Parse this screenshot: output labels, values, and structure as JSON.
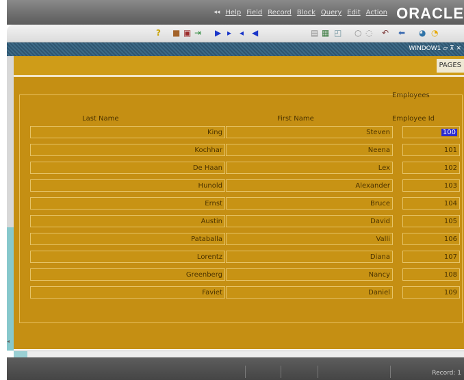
{
  "menu": {
    "items": [
      "Help",
      "Field",
      "Record",
      "Block",
      "Query",
      "Edit",
      "Action"
    ],
    "logo": "ORACLE"
  },
  "toolbar": {
    "icons": [
      "help-icon",
      "save-icon",
      "print-icon",
      "exit-icon",
      "first-record-icon",
      "next-record-icon",
      "previous-record-icon",
      "last-record-icon",
      "new-record-icon",
      "delete-record-icon",
      "find-icon",
      "list-icon",
      "clear-icon",
      "undo-icon",
      "back-icon",
      "zoom-icon",
      "warning-icon"
    ]
  },
  "window": {
    "title": "WINDOW1"
  },
  "tab": {
    "label": "PAGES"
  },
  "block": {
    "title": "Employees",
    "headers": {
      "last_name": "Last Name",
      "first_name": "First Name",
      "employee_id": "Employee Id"
    },
    "rows": [
      {
        "last": "King",
        "first": "Steven",
        "id": "100"
      },
      {
        "last": "Kochhar",
        "first": "Neena",
        "id": "101"
      },
      {
        "last": "De Haan",
        "first": "Lex",
        "id": "102"
      },
      {
        "last": "Hunold",
        "first": "Alexander",
        "id": "103"
      },
      {
        "last": "Ernst",
        "first": "Bruce",
        "id": "104"
      },
      {
        "last": "Austin",
        "first": "David",
        "id": "105"
      },
      {
        "last": "Pataballa",
        "first": "Valli",
        "id": "106"
      },
      {
        "last": "Lorentz",
        "first": "Diana",
        "id": "107"
      },
      {
        "last": "Greenberg",
        "first": "Nancy",
        "id": "108"
      },
      {
        "last": "Faviet",
        "first": "Daniel",
        "id": "109"
      }
    ]
  },
  "status": {
    "record": "Record: 1"
  },
  "colors": {
    "canvas": "#c58f13",
    "field_border": "#e6c468",
    "title_bar": "#3d6a86",
    "selection": "#2a2ad0"
  }
}
